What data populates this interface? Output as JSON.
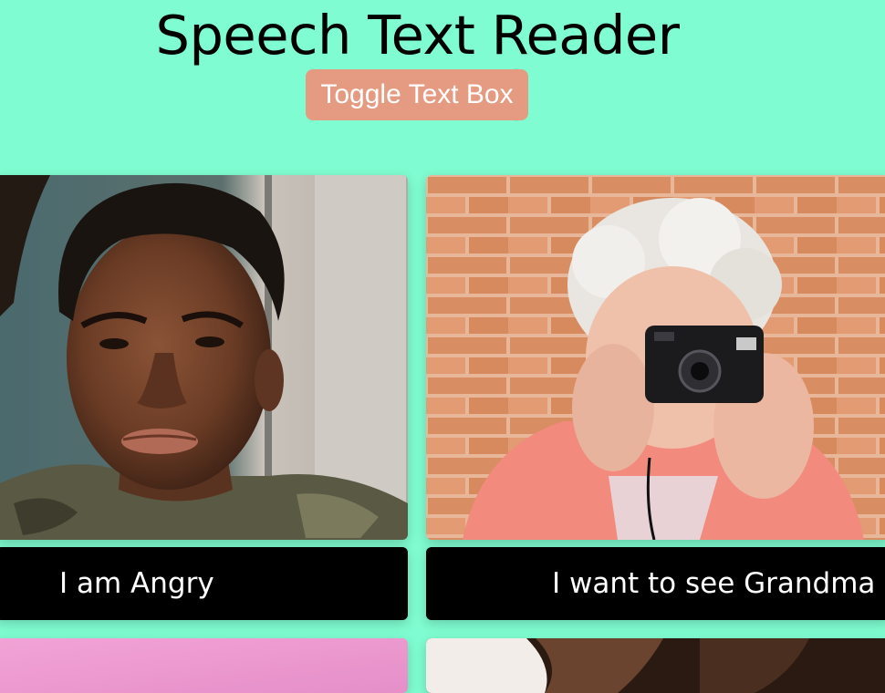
{
  "header": {
    "title": "Speech Text Reader",
    "toggle_label": "Toggle Text Box"
  },
  "colors": {
    "background": "#7ffcd1",
    "button": "#e59b81",
    "caption_bg": "#000000",
    "caption_text": "#ffffff"
  },
  "cards": [
    {
      "image": "angry-boy-photo",
      "caption": "I am Angry"
    },
    {
      "image": "grandma-camera-photo",
      "caption": "I want to see Grandma"
    },
    {
      "image": "pink-photo",
      "caption": ""
    },
    {
      "image": "face-closeup-photo",
      "caption": ""
    }
  ]
}
